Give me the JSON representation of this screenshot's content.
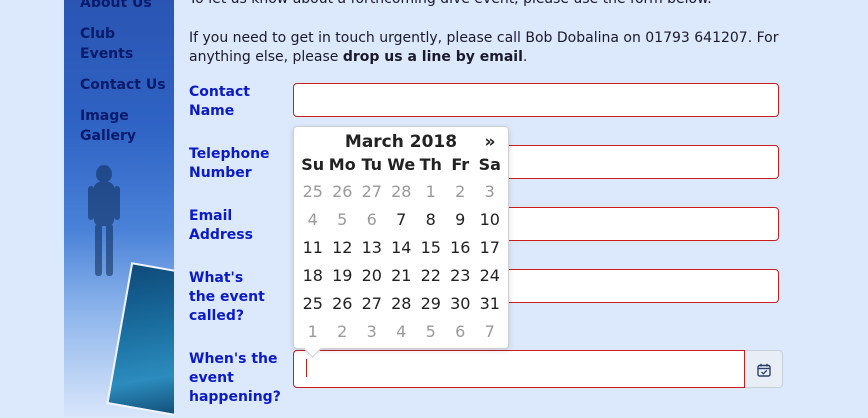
{
  "sidebar": {
    "items": [
      {
        "label": "About Us"
      },
      {
        "label": "Club Events"
      },
      {
        "label": "Contact Us"
      },
      {
        "label": "Image Gallery"
      }
    ]
  },
  "intro": {
    "line1": "To let us know about a forthcoming dive event, please use the form below.",
    "line2_pre": "If you need to get in touch urgently, please call Bob Dobalina on 01793 641207. For anything else, please ",
    "line2_bold": "drop us a line by email",
    "line2_post": "."
  },
  "form": {
    "contact_name_label": "Contact Name",
    "telephone_label": "Telephone Number",
    "email_label": "Email Address",
    "event_name_label": "What's the event called?",
    "event_date_label": "When's the event happening?"
  },
  "datepicker": {
    "title": "March 2018",
    "next": "»",
    "weekdays": [
      "Su",
      "Mo",
      "Tu",
      "We",
      "Th",
      "Fr",
      "Sa"
    ],
    "weeks": [
      [
        {
          "d": "25",
          "o": true
        },
        {
          "d": "26",
          "o": true
        },
        {
          "d": "27",
          "o": true
        },
        {
          "d": "28",
          "o": true
        },
        {
          "d": "1",
          "o": true
        },
        {
          "d": "2",
          "o": true
        },
        {
          "d": "3",
          "o": true
        }
      ],
      [
        {
          "d": "4",
          "o": true
        },
        {
          "d": "5",
          "o": true
        },
        {
          "d": "6",
          "o": true
        },
        {
          "d": "7",
          "o": false
        },
        {
          "d": "8",
          "o": false
        },
        {
          "d": "9",
          "o": false
        },
        {
          "d": "10",
          "o": false
        }
      ],
      [
        {
          "d": "11",
          "o": false
        },
        {
          "d": "12",
          "o": false
        },
        {
          "d": "13",
          "o": false
        },
        {
          "d": "14",
          "o": false
        },
        {
          "d": "15",
          "o": false
        },
        {
          "d": "16",
          "o": false
        },
        {
          "d": "17",
          "o": false
        }
      ],
      [
        {
          "d": "18",
          "o": false
        },
        {
          "d": "19",
          "o": false
        },
        {
          "d": "20",
          "o": false
        },
        {
          "d": "21",
          "o": false
        },
        {
          "d": "22",
          "o": false
        },
        {
          "d": "23",
          "o": false
        },
        {
          "d": "24",
          "o": false
        }
      ],
      [
        {
          "d": "25",
          "o": false
        },
        {
          "d": "26",
          "o": false
        },
        {
          "d": "27",
          "o": false
        },
        {
          "d": "28",
          "o": false
        },
        {
          "d": "29",
          "o": false
        },
        {
          "d": "30",
          "o": false
        },
        {
          "d": "31",
          "o": false
        }
      ],
      [
        {
          "d": "1",
          "o": true
        },
        {
          "d": "2",
          "o": true
        },
        {
          "d": "3",
          "o": true
        },
        {
          "d": "4",
          "o": true
        },
        {
          "d": "5",
          "o": true
        },
        {
          "d": "6",
          "o": true
        },
        {
          "d": "7",
          "o": true
        }
      ]
    ]
  },
  "icons": {
    "calendar": "calendar-icon"
  },
  "colors": {
    "label": "#0a1ac8",
    "field_border": "#cc1d1d",
    "sidebar_text": "#0a1a6a"
  }
}
